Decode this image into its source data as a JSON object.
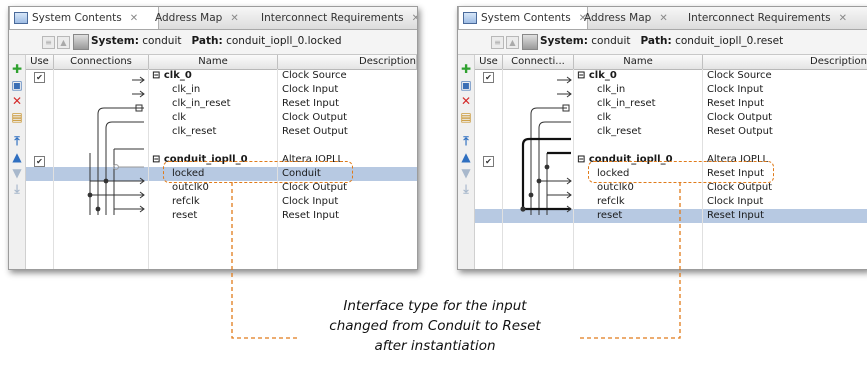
{
  "tabs": [
    "System Contents",
    "Address Map",
    "Interconnect Requirements"
  ],
  "left_panel": {
    "path_label": "System:",
    "system_name": "conduit",
    "path_key": "Path:",
    "path_value": "conduit_iopll_0.locked",
    "headers": [
      "Use",
      "Connections",
      "Name",
      "Description"
    ],
    "rows": [
      {
        "name": "clk_0",
        "desc": "Clock Source"
      },
      {
        "name": "clk_in",
        "desc": "Clock Input"
      },
      {
        "name": "clk_in_reset",
        "desc": "Reset Input"
      },
      {
        "name": "clk",
        "desc": "Clock Output"
      },
      {
        "name": "clk_reset",
        "desc": "Reset Output"
      },
      {
        "name": "conduit_iopll_0",
        "desc": "Altera IOPLL"
      },
      {
        "name": "locked",
        "desc": "Conduit"
      },
      {
        "name": "outclk0",
        "desc": "Clock Output"
      },
      {
        "name": "refclk",
        "desc": "Clock Input"
      },
      {
        "name": "reset",
        "desc": "Reset Input"
      }
    ]
  },
  "right_panel": {
    "path_label": "System:",
    "system_name": "conduit",
    "path_key": "Path:",
    "path_value": "conduit_iopll_0.reset",
    "headers": [
      "Use",
      "Connecti...",
      "Name",
      "Description"
    ],
    "rows": [
      {
        "name": "clk_0",
        "desc": "Clock Source"
      },
      {
        "name": "clk_in",
        "desc": "Clock Input"
      },
      {
        "name": "clk_in_reset",
        "desc": "Reset Input"
      },
      {
        "name": "clk",
        "desc": "Clock Output"
      },
      {
        "name": "clk_reset",
        "desc": "Reset Output"
      },
      {
        "name": "conduit_iopll_0",
        "desc": "Altera IOPLL"
      },
      {
        "name": "locked",
        "desc": "Reset Input"
      },
      {
        "name": "outclk0",
        "desc": "Clock Output"
      },
      {
        "name": "refclk",
        "desc": "Clock Input"
      },
      {
        "name": "reset",
        "desc": "Reset Input"
      }
    ]
  },
  "caption": {
    "line1": "Interface type for the input",
    "line2": "changed from Conduit to Reset",
    "line3": "after instantiation"
  },
  "colors": {
    "highlight": "#e07b1a",
    "selection": "#b7c9e2"
  }
}
